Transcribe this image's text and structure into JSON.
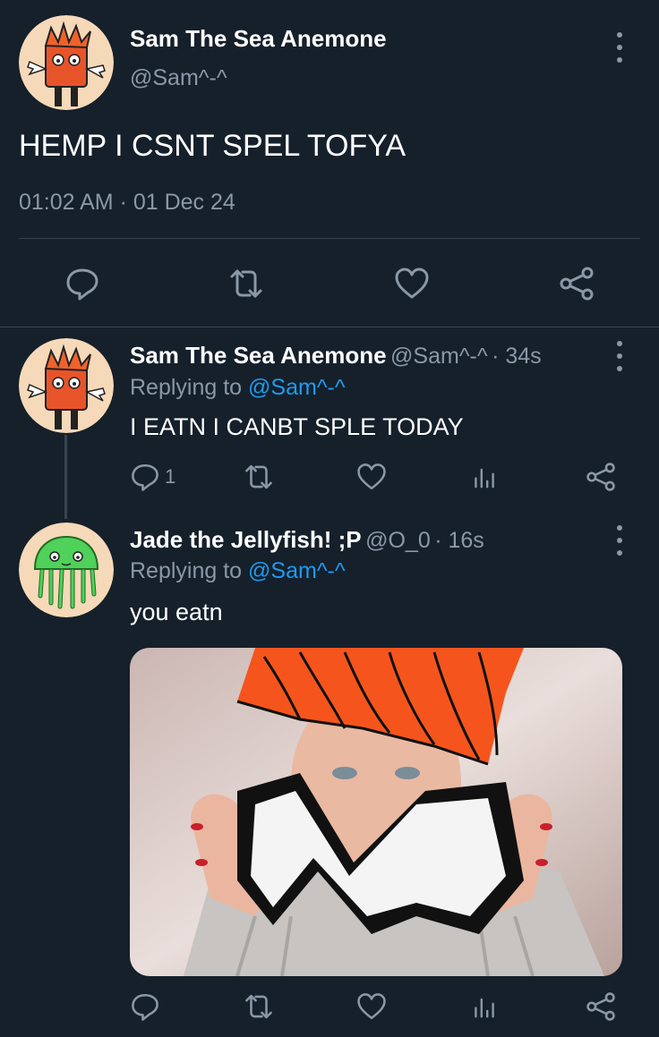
{
  "main_tweet": {
    "display_name": "Sam The Sea Anemone",
    "handle": "@Sam^-^",
    "text": "HEMP I CSNT SPEL TOFYA",
    "timestamp": "01:02 AM · 01 Dec 24",
    "actions": [
      "reply",
      "retweet",
      "like",
      "share"
    ]
  },
  "reply_1": {
    "display_name": "Sam The Sea Anemone",
    "handle": "@Sam^-^",
    "time": "· 34s",
    "replying_to_label": "Replying to",
    "replying_to_handle": "@Sam^-^",
    "text": "I EATN I CANBT SPLE TODAY",
    "reply_count": "1"
  },
  "reply_2": {
    "display_name": "Jade the Jellyfish! ;P",
    "handle": "@O_0",
    "time": "· 16s",
    "replying_to_label": "Replying to",
    "replying_to_handle": "@Sam^-^",
    "text": "you eatn"
  },
  "colors": {
    "background": "#15202b",
    "text": "#ffffff",
    "muted": "#8b98a5",
    "link": "#1d9bf0",
    "divider": "#38444d"
  }
}
